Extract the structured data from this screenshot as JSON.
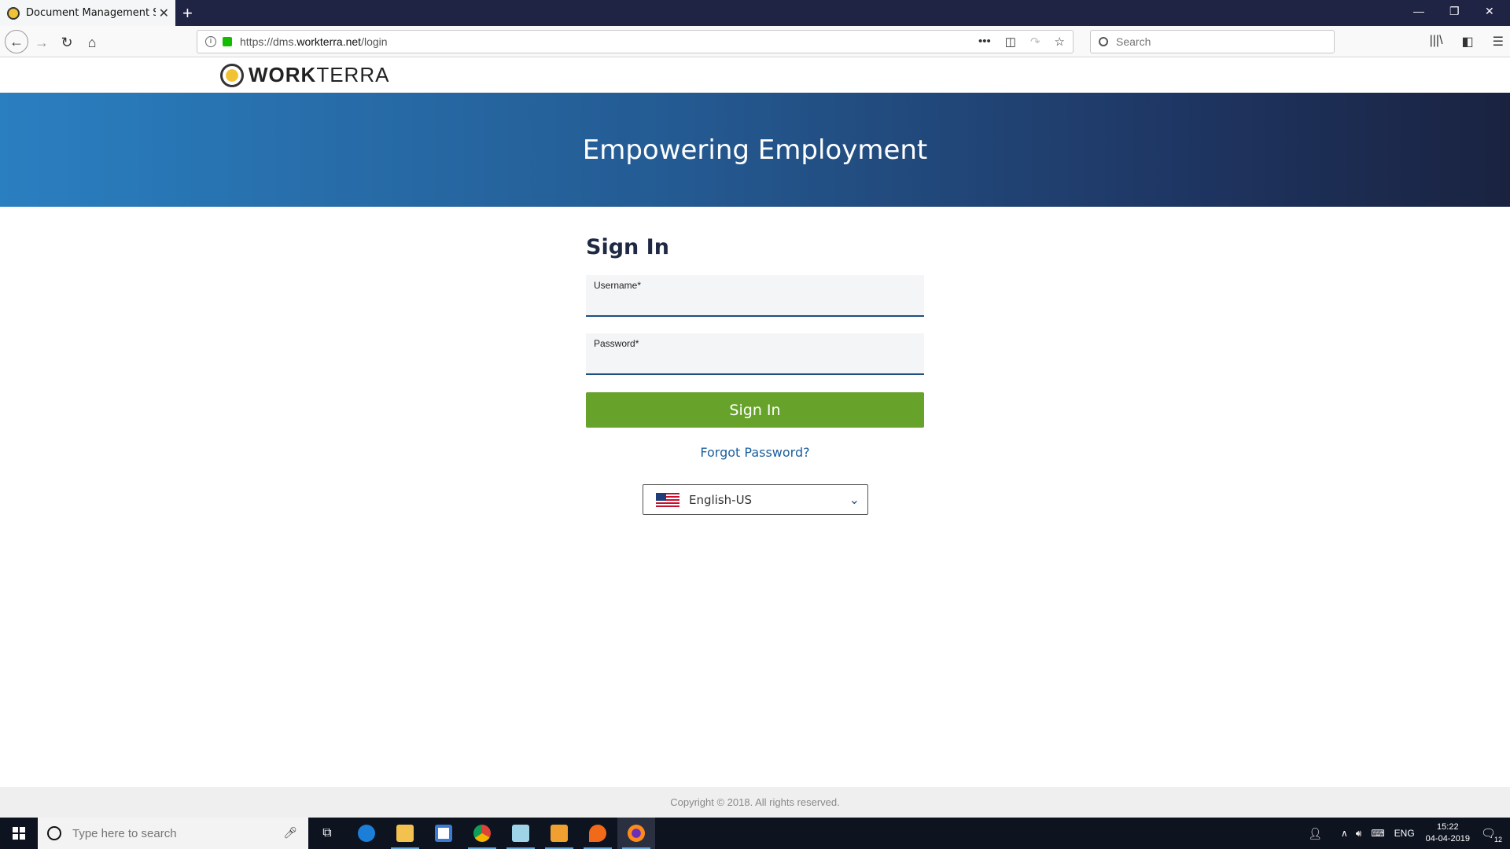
{
  "browser": {
    "tab_title": "Document Management Servic",
    "url_prefix": "https://dms.",
    "url_domain": "workterra.net",
    "url_path": "/login",
    "search_placeholder": "Search"
  },
  "site": {
    "logo_bold": "WORK",
    "logo_rest": "TERRA",
    "hero_title": "Empowering Employment"
  },
  "signin": {
    "heading": "Sign In",
    "username_label": "Username*",
    "username_value": "",
    "password_label": "Password*",
    "password_value": "",
    "button_label": "Sign In",
    "forgot_label": "Forgot Password?",
    "language": "English-US"
  },
  "footer": {
    "copyright": "Copyright © 2018. All rights reserved."
  },
  "taskbar": {
    "search_placeholder": "Type here to search",
    "lang": "ENG",
    "time": "15:22",
    "date": "04-04-2019",
    "notifications": "12"
  },
  "colors": {
    "accent_green": "#67a32b",
    "link_blue": "#1a5f9e",
    "hero_start": "#2a7fc0",
    "hero_end": "#1a2240"
  }
}
